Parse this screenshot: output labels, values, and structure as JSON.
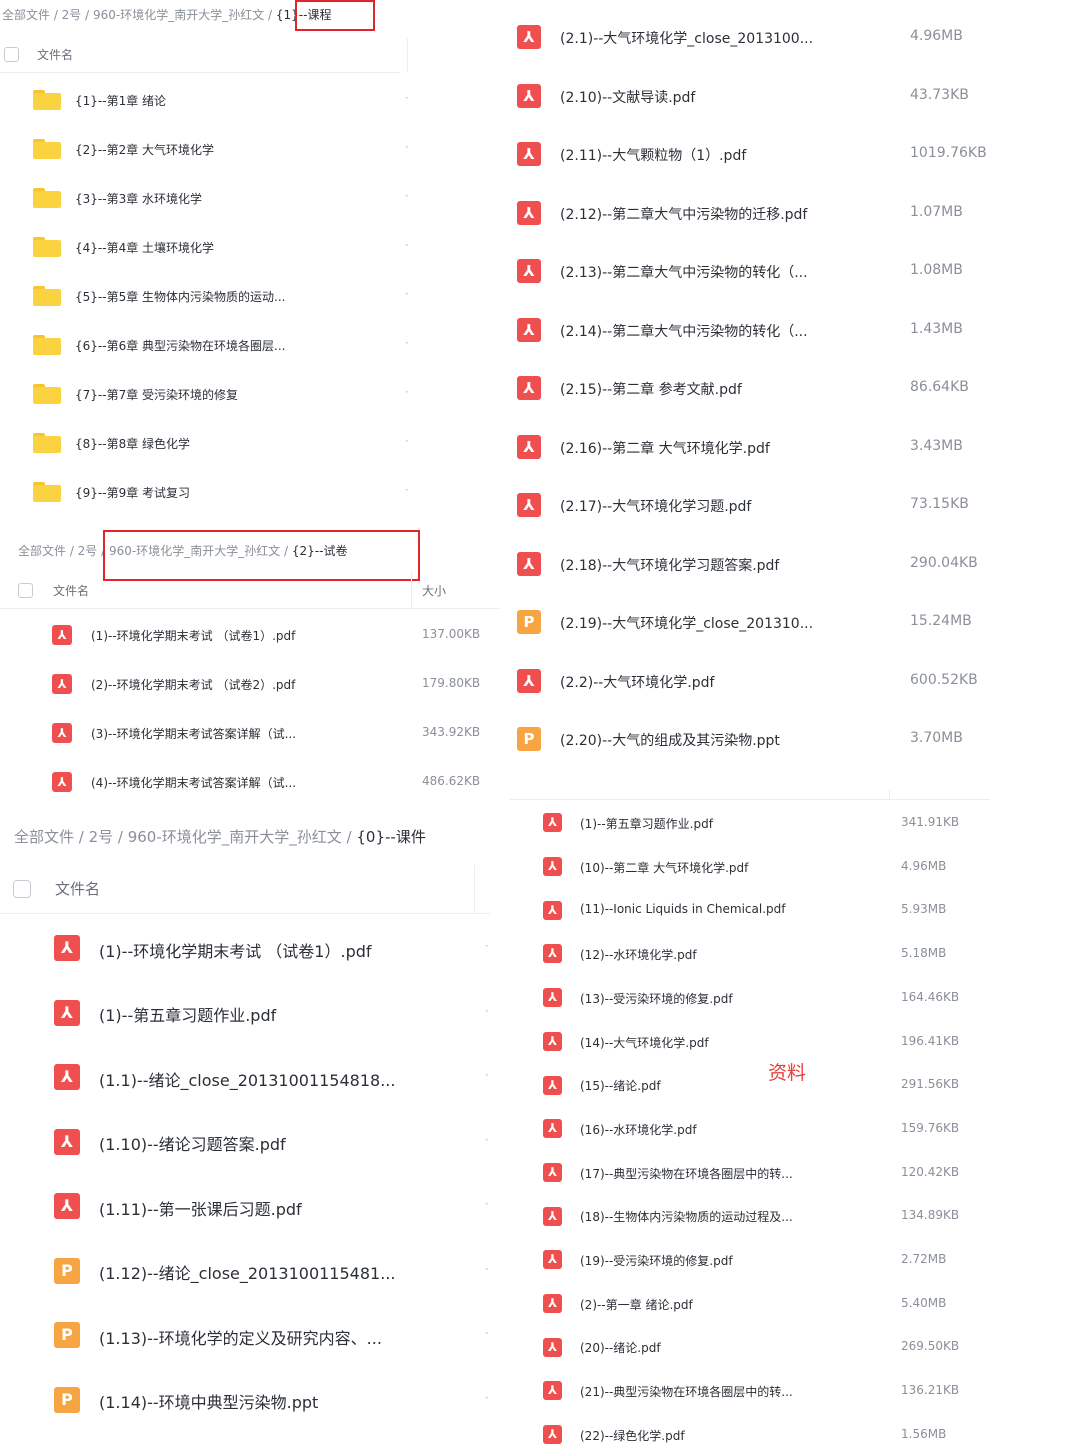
{
  "colors": {
    "pdf": "#f04f4f",
    "ppt": "#f7a543",
    "folder": "#fbd23f",
    "highlight": "#e0262b"
  },
  "icons": {
    "pdf": "pdf-file-icon",
    "ppt": "ppt-file-icon",
    "folder": "folder-icon",
    "pdf_glyph": "⅄",
    "ppt_glyph": "P"
  },
  "panel1": {
    "breadcrumb": {
      "path": "全部文件 / 2号 / 960-环境化学_南开大学_孙红文 / ",
      "current": "{1}--课程"
    },
    "col_name": "文件名",
    "rows": [
      {
        "name": "{1}--第1章 绪论"
      },
      {
        "name": "{2}--第2章 大气环境化学"
      },
      {
        "name": "{3}--第3章 水环境化学"
      },
      {
        "name": "{4}--第4章 土壤环境化学"
      },
      {
        "name": "{5}--第5章 生物体内污染物质的运动..."
      },
      {
        "name": "{6}--第6章 典型污染物在环境各圈层..."
      },
      {
        "name": "{7}--第7章 受污染环境的修复"
      },
      {
        "name": "{8}--第8章 绿色化学"
      },
      {
        "name": "{9}--第9章 考试复习"
      }
    ]
  },
  "panel2": {
    "breadcrumb": {
      "path": "全部文件 / 2号 / 960-环境化学_南开大学_孙红文 / ",
      "current": "{2}--试卷"
    },
    "col_name": "文件名",
    "col_size": "大小",
    "rows": [
      {
        "type": "pdf",
        "name": "(1)--环境化学期末考试 （试卷1）.pdf",
        "size": "137.00KB"
      },
      {
        "type": "pdf",
        "name": "(2)--环境化学期末考试 （试卷2）.pdf",
        "size": "179.80KB"
      },
      {
        "type": "pdf",
        "name": "(3)--环境化学期末考试答案详解（试...",
        "size": "343.92KB"
      },
      {
        "type": "pdf",
        "name": "(4)--环境化学期末考试答案详解（试...",
        "size": "486.62KB"
      }
    ]
  },
  "panel3": {
    "breadcrumb": {
      "path": "全部文件 / 2号 / 960-环境化学_南开大学_孙红文 / ",
      "current": "{0}--课件"
    },
    "col_name": "文件名",
    "rows": [
      {
        "type": "pdf",
        "name": "(1)--环境化学期末考试 （试卷1）.pdf"
      },
      {
        "type": "pdf",
        "name": "(1)--第五章习题作业.pdf"
      },
      {
        "type": "pdf",
        "name": "(1.1)--绪论_close_20131001154818..."
      },
      {
        "type": "pdf",
        "name": "(1.10)--绪论习题答案.pdf"
      },
      {
        "type": "pdf",
        "name": "(1.11)--第一张课后习题.pdf"
      },
      {
        "type": "ppt",
        "name": "(1.12)--绪论_close_2013100115481..."
      },
      {
        "type": "ppt",
        "name": "(1.13)--环境化学的定义及研究内容、..."
      },
      {
        "type": "ppt",
        "name": "(1.14)--环境中典型污染物.ppt"
      }
    ]
  },
  "panel4": {
    "rows": [
      {
        "type": "pdf",
        "name": "(2.1)--大气环境化学_close_2013100...",
        "size": "4.96MB"
      },
      {
        "type": "pdf",
        "name": "(2.10)--文献导读.pdf",
        "size": "43.73KB"
      },
      {
        "type": "pdf",
        "name": "(2.11)--大气颗粒物（1）.pdf",
        "size": "1019.76KB"
      },
      {
        "type": "pdf",
        "name": "(2.12)--第二章大气中污染物的迁移.pdf",
        "size": "1.07MB"
      },
      {
        "type": "pdf",
        "name": "(2.13)--第二章大气中污染物的转化（...",
        "size": "1.08MB"
      },
      {
        "type": "pdf",
        "name": "(2.14)--第二章大气中污染物的转化（...",
        "size": "1.43MB"
      },
      {
        "type": "pdf",
        "name": "(2.15)--第二章 参考文献.pdf",
        "size": "86.64KB"
      },
      {
        "type": "pdf",
        "name": "(2.16)--第二章 大气环境化学.pdf",
        "size": "3.43MB"
      },
      {
        "type": "pdf",
        "name": "(2.17)--大气环境化学习题.pdf",
        "size": "73.15KB"
      },
      {
        "type": "pdf",
        "name": "(2.18)--大气环境化学习题答案.pdf",
        "size": "290.04KB"
      },
      {
        "type": "ppt",
        "name": "(2.19)--大气环境化学_close_201310...",
        "size": "15.24MB"
      },
      {
        "type": "pdf",
        "name": "(2.2)--大气环境化学.pdf",
        "size": "600.52KB"
      },
      {
        "type": "ppt",
        "name": "(2.20)--大气的组成及其污染物.ppt",
        "size": "3.70MB"
      }
    ]
  },
  "panel5": {
    "watermark": "资料",
    "rows": [
      {
        "type": "pdf",
        "name": "(1)--第五章习题作业.pdf",
        "size": "341.91KB"
      },
      {
        "type": "pdf",
        "name": "(10)--第二章 大气环境化学.pdf",
        "size": "4.96MB"
      },
      {
        "type": "pdf",
        "name": "(11)--Ionic Liquids in Chemical.pdf",
        "size": "5.93MB"
      },
      {
        "type": "pdf",
        "name": "(12)--水环境化学.pdf",
        "size": "5.18MB"
      },
      {
        "type": "pdf",
        "name": "(13)--受污染环境的修复.pdf",
        "size": "164.46KB"
      },
      {
        "type": "pdf",
        "name": "(14)--大气环境化学.pdf",
        "size": "196.41KB"
      },
      {
        "type": "pdf",
        "name": "(15)--绪论.pdf",
        "size": "291.56KB"
      },
      {
        "type": "pdf",
        "name": "(16)--水环境化学.pdf",
        "size": "159.76KB"
      },
      {
        "type": "pdf",
        "name": "(17)--典型污染物在环境各圈层中的转...",
        "size": "120.42KB"
      },
      {
        "type": "pdf",
        "name": "(18)--生物体内污染物质的运动过程及...",
        "size": "134.89KB"
      },
      {
        "type": "pdf",
        "name": "(19)--受污染环境的修复.pdf",
        "size": "2.72MB"
      },
      {
        "type": "pdf",
        "name": "(2)--第一章 绪论.pdf",
        "size": "5.40MB"
      },
      {
        "type": "pdf",
        "name": "(20)--绪论.pdf",
        "size": "269.50KB"
      },
      {
        "type": "pdf",
        "name": "(21)--典型污染物在环境各圈层中的转...",
        "size": "136.21KB"
      },
      {
        "type": "pdf",
        "name": "(22)--绿色化学.pdf",
        "size": "1.56MB"
      }
    ]
  }
}
